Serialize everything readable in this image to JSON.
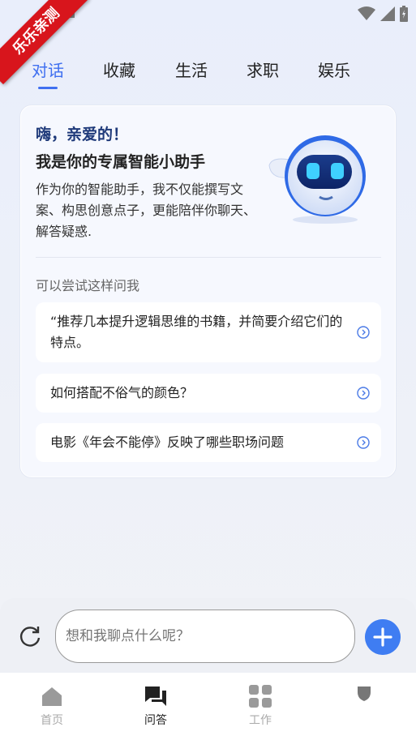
{
  "badge": {
    "text": "乐乐亲测"
  },
  "tabs": [
    {
      "label": "对话",
      "active": true
    },
    {
      "label": "收藏",
      "active": false
    },
    {
      "label": "生活",
      "active": false
    },
    {
      "label": "求职",
      "active": false
    },
    {
      "label": "娱乐",
      "active": false
    }
  ],
  "card": {
    "greeting": "嗨，亲爱的！",
    "subtitle": "我是你的专属智能小助手",
    "intro": "作为你的智能助手，我不仅能撰写文案、构思创意点子，更能陪伴你聊天、解答疑惑.",
    "try_label": "可以尝试这样问我",
    "suggestions": [
      "“推荐几本提升逻辑思维的书籍，并简要介绍它们的特点。",
      "如何搭配不俗气的颜色？",
      "电影《年会不能停》反映了哪些职场问题"
    ]
  },
  "input": {
    "placeholder": "想和我聊点什么呢？"
  },
  "nav": [
    {
      "label": "首页",
      "icon": "home-icon",
      "active": false
    },
    {
      "label": "问答",
      "icon": "chat-icon",
      "active": true
    },
    {
      "label": "工作",
      "icon": "grid-icon",
      "active": false
    },
    {
      "label": "",
      "icon": "shield-icon",
      "active": false
    }
  ],
  "colors": {
    "accent": "#3f6ff0",
    "badge": "#d8151c",
    "plus": "#3f7df2"
  }
}
